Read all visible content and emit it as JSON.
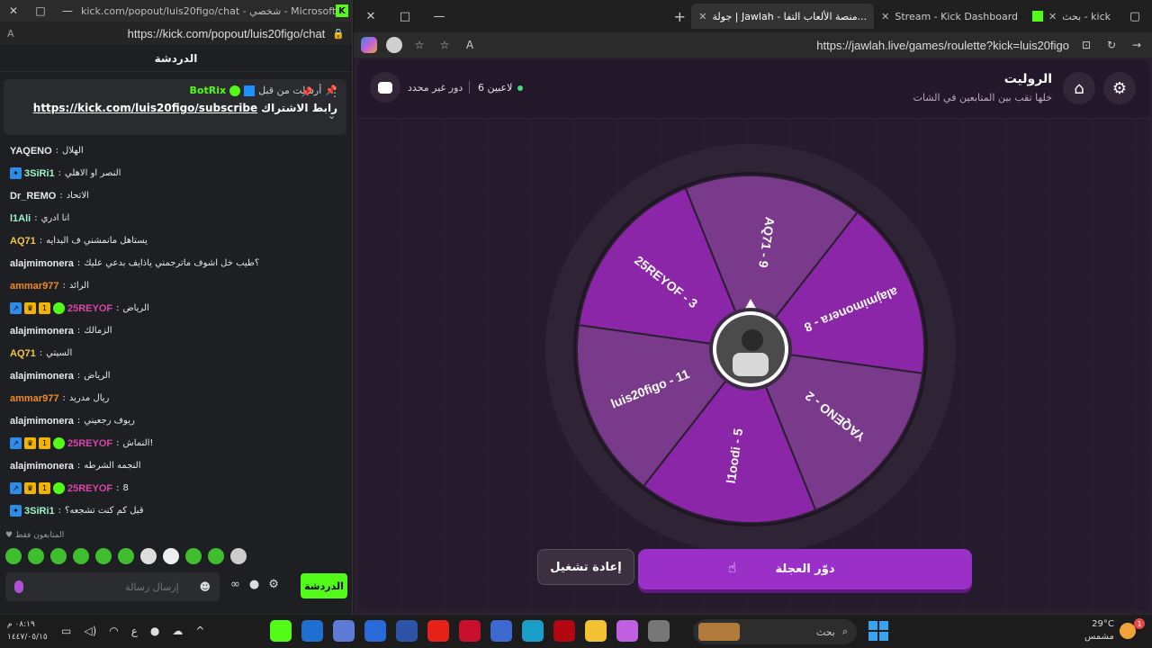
{
  "left_window": {
    "title": "kick.com/popout/luis20figo/chat - شخصي - Microsoft Ed...",
    "url": "https://kick.com/popout/luis20figo/chat",
    "reader_icon": "A",
    "chat_header": "الدردشة",
    "pinned": {
      "sent_by": "أرسلت من قبل",
      "bot_name": "BotRix",
      "link_label": "رابط الاشتراك",
      "link": "https://kick.com/luis20figo/subscribe"
    },
    "messages": [
      {
        "user": "YAQENO",
        "color": "#e8e8e8",
        "badges": [],
        "text": "الهلال"
      },
      {
        "user": "3SiRi1",
        "color": "#9ef3c9",
        "badges": [
          "sub"
        ],
        "text": "النصر او الاهلي"
      },
      {
        "user": "Dr_REMO",
        "color": "#e8e8e8",
        "badges": [],
        "text": "الاتحاد"
      },
      {
        "user": "l1Ali",
        "color": "#9ef3c9",
        "badges": [],
        "text": "انا ادري"
      },
      {
        "user": "AQ71",
        "color": "#f5c542",
        "badges": [],
        "text": "يستاهل مانمشني ف البدايه"
      },
      {
        "user": "alajmimonera",
        "color": "#e8e8e8",
        "badges": [],
        "text": "؟طيب خل اشوف ماترجمني ياذايف بدعي عليك"
      },
      {
        "user": "ammar977",
        "color": "#f08a24",
        "badges": [],
        "text": "الرائد"
      },
      {
        "user": "25REYOF",
        "color": "#d946a8",
        "badges": [
          "mod",
          "crown",
          "one",
          "gem"
        ],
        "text": "الرياض"
      },
      {
        "user": "alajmimonera",
        "color": "#e8e8e8",
        "badges": [],
        "text": "الزمالك"
      },
      {
        "user": "AQ71",
        "color": "#f5c542",
        "badges": [],
        "text": "السيتي"
      },
      {
        "user": "alajmimonera",
        "color": "#e8e8e8",
        "badges": [],
        "text": "الرياض"
      },
      {
        "user": "ammar977",
        "color": "#f08a24",
        "badges": [],
        "text": "ريال مدريد"
      },
      {
        "user": "alajmimonera",
        "color": "#e8e8e8",
        "badges": [],
        "text": "ريوف رجعيني"
      },
      {
        "user": "25REYOF",
        "color": "#d946a8",
        "badges": [
          "mod",
          "crown",
          "one",
          "gem"
        ],
        "text": "النماش!"
      },
      {
        "user": "alajmimonera",
        "color": "#e8e8e8",
        "badges": [],
        "text": "النجمه الشرطه"
      },
      {
        "user": "25REYOF",
        "color": "#d946a8",
        "badges": [
          "mod",
          "crown",
          "one",
          "gem"
        ],
        "text": "8"
      },
      {
        "user": "3SiRi1",
        "color": "#9ef3c9",
        "badges": [
          "sub"
        ],
        "text": "قبل كم كنت تشجعه؟"
      }
    ],
    "followers_only": "المتابعون فقط",
    "input_placeholder": "إرسال رسالة",
    "send_button": "الدردشة"
  },
  "right_window": {
    "tabs": [
      {
        "label": "جولة | Jawlah - منصة الألعاب التفا...",
        "active": true
      },
      {
        "label": "Stream - Kick Dashboard",
        "active": false
      },
      {
        "label": "بحث - kick",
        "active": false
      }
    ],
    "url": "https://jawlah.live/games/roulette?kick=luis20figo",
    "page": {
      "title": "الروليت",
      "subtitle": "خلها تقب بين المتابعين في الشات",
      "players": "6 لاعبين",
      "round": "دور غير محدد",
      "respin_button": "إعادة تشغيل",
      "spin_button": "دوّر العجلة"
    },
    "wheel": {
      "slices": [
        {
          "label": "AQ71 - 9",
          "color": "#7a3a8c"
        },
        {
          "label": "alajmimonera - 8",
          "color": "#8b26a8"
        },
        {
          "label": "YAQENO - 2",
          "color": "#7a3a8c"
        },
        {
          "label": "l1oodi - 5",
          "color": "#8b26a8"
        },
        {
          "label": "luis20figo - 11",
          "color": "#7a3a8c"
        },
        {
          "label": "25REYOF - 3",
          "color": "#8b26a8"
        }
      ],
      "start_deg": -22
    }
  },
  "taskbar": {
    "time": "٠٨:١٩ م",
    "date": "١٤٤٧/٠٥/١٥",
    "lang": "ع",
    "search_label": "بحث",
    "temperature": "29°C",
    "weather": "مشمس",
    "notif_count": "1"
  },
  "colors": {
    "kick_green": "#53fc18",
    "accent_purple": "#9b30c8",
    "page_bg": "#261a2d"
  }
}
